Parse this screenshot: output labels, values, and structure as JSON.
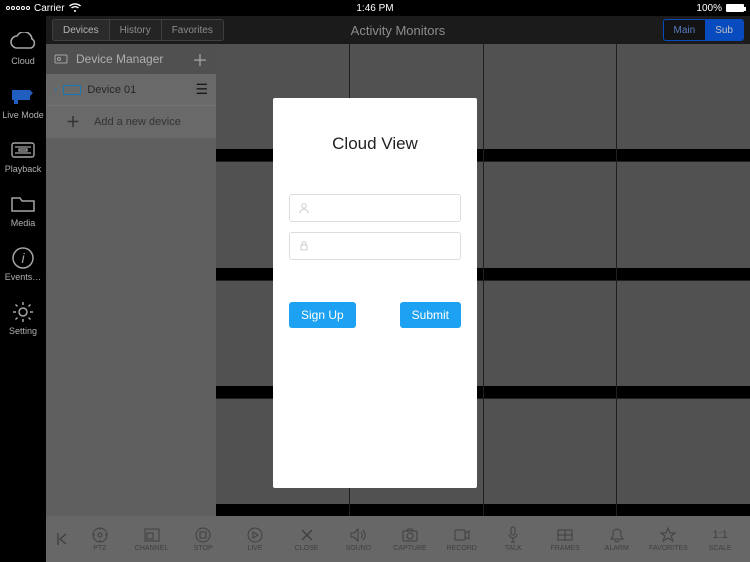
{
  "statusbar": {
    "carrier": "Carrier",
    "time": "1:46 PM",
    "battery": "100%"
  },
  "rail": {
    "items": [
      {
        "id": "cloud",
        "label": "Cloud"
      },
      {
        "id": "live",
        "label": "Live Mode"
      },
      {
        "id": "playback",
        "label": "Playback"
      },
      {
        "id": "media",
        "label": "Media"
      },
      {
        "id": "events",
        "label": "Events…"
      },
      {
        "id": "setting",
        "label": "Setting"
      }
    ]
  },
  "header": {
    "tabs": [
      "Devices",
      "History",
      "Favorites"
    ],
    "title": "Activity Monitors",
    "stream": {
      "main": "Main",
      "sub": "Sub"
    }
  },
  "device_pane": {
    "title": "Device Manager",
    "device1": "Device 01",
    "add": "Add a new device"
  },
  "tools": [
    {
      "id": "collapse",
      "label": ""
    },
    {
      "id": "ptz",
      "label": "PTZ"
    },
    {
      "id": "channel",
      "label": "CHANNEL"
    },
    {
      "id": "stop",
      "label": "STOP"
    },
    {
      "id": "live",
      "label": "LIVE"
    },
    {
      "id": "close",
      "label": "CLOSE"
    },
    {
      "id": "sound",
      "label": "SOUND"
    },
    {
      "id": "capture",
      "label": "CAPTURE"
    },
    {
      "id": "record",
      "label": "RECORD"
    },
    {
      "id": "talk",
      "label": "TALK"
    },
    {
      "id": "frames",
      "label": "FRAMES"
    },
    {
      "id": "alarm",
      "label": "ALARM"
    },
    {
      "id": "favorites",
      "label": "FAVORITES"
    },
    {
      "id": "scale",
      "label": "SCALE"
    }
  ],
  "modal": {
    "title": "Cloud View",
    "signup": "Sign Up",
    "submit": "Submit"
  }
}
